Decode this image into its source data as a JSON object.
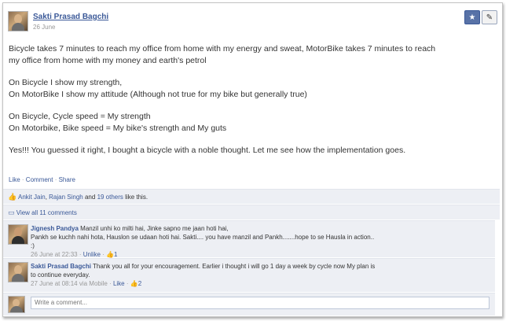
{
  "post": {
    "author": "Sakti Prasad Bagchi",
    "date": "26 June",
    "paragraphs": [
      [
        "Bicycle takes 7 minutes to reach my office from home with my energy and sweat, MotorBike takes 7 minutes to reach",
        "my office from home with my money and earth's petrol"
      ],
      [
        "On Bicycle I show my strength,",
        "On MotorBike I show my attitude (Although not true for my bike but generally true)"
      ],
      [
        "On Bicycle, Cycle speed = My strength",
        "On Motorbike, Bike speed = My bike's strength and My guts"
      ],
      [
        "Yes!!! You guessed it right, I bought a bicycle with a noble thought. Let me see how the implementation goes."
      ]
    ]
  },
  "actions": {
    "like": "Like",
    "comment": "Comment",
    "share": "Share",
    "sep": " · "
  },
  "likes": {
    "name1": "Ankit Jain",
    "name2": "Rajan Singh",
    "and": "and",
    "others": "19 others",
    "suffix": "like this."
  },
  "view_all": "View all 11 comments",
  "comments": [
    {
      "author": "Jignesh Pandya",
      "line1": "Manzil unhi ko milti hai, Jinke sapno me jaan hoti hai,",
      "line2": "Pankh se kuchh nahi hota, Hauslon se udaan hoti hai. Sakti.... you have manzil and Pankh.......hope to se Hausla in action..",
      "line3": ":)",
      "time": "26 June at 22:33",
      "unlike": "Unlike",
      "count": "1"
    },
    {
      "author": "Sakti Prasad Bagchi",
      "line1": "Thank you all for your encouragement. Earlier i thought i will go 1 day a week by cycle now My plan is",
      "line2": "to continue everyday.",
      "time": "27 June at 08:14 via Mobile",
      "like": "Like",
      "count": "2"
    }
  ],
  "write_placeholder": "Write a comment..."
}
